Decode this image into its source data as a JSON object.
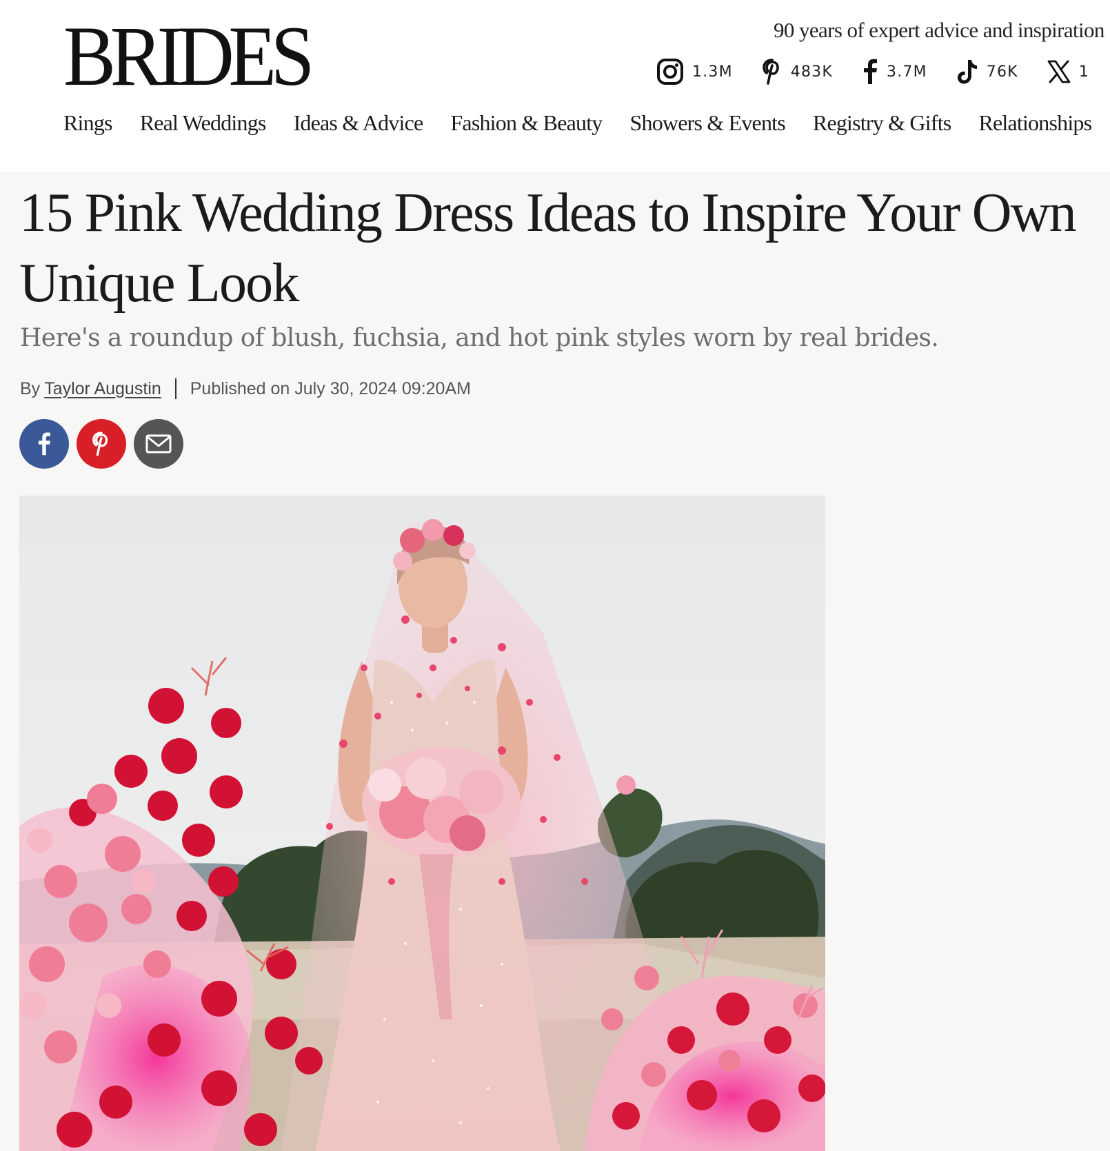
{
  "brand": {
    "logo_text": "BRIDES",
    "tagline": "90 years of expert advice and inspiration"
  },
  "social": [
    {
      "icon": "instagram-icon",
      "count": "1.3M"
    },
    {
      "icon": "pinterest-icon",
      "count": "483K"
    },
    {
      "icon": "facebook-icon",
      "count": "3.7M"
    },
    {
      "icon": "tiktok-icon",
      "count": "76K"
    },
    {
      "icon": "x-icon",
      "count": "1"
    }
  ],
  "nav": [
    "Rings",
    "Real Weddings",
    "Ideas & Advice",
    "Fashion & Beauty",
    "Showers & Events",
    "Registry & Gifts",
    "Relationships"
  ],
  "article": {
    "title": "15 Pink Wedding Dress Ideas to Inspire Your Own Unique Look",
    "dek": "Here's a roundup of blush, fuchsia, and hot pink styles worn by real brides.",
    "byline_prefix": "By",
    "author": "Taylor Augustin",
    "published": "Published on July 30, 2024 09:20AM"
  },
  "share": [
    {
      "icon": "facebook-icon",
      "color": "#3b5998"
    },
    {
      "icon": "pinterest-icon",
      "color": "#d81f27"
    },
    {
      "icon": "email-icon",
      "color": "#555555"
    }
  ],
  "colors": {
    "page_background": "#f8f7f5",
    "header_background": "#ffffff",
    "dek_text": "#6d6d6d"
  }
}
